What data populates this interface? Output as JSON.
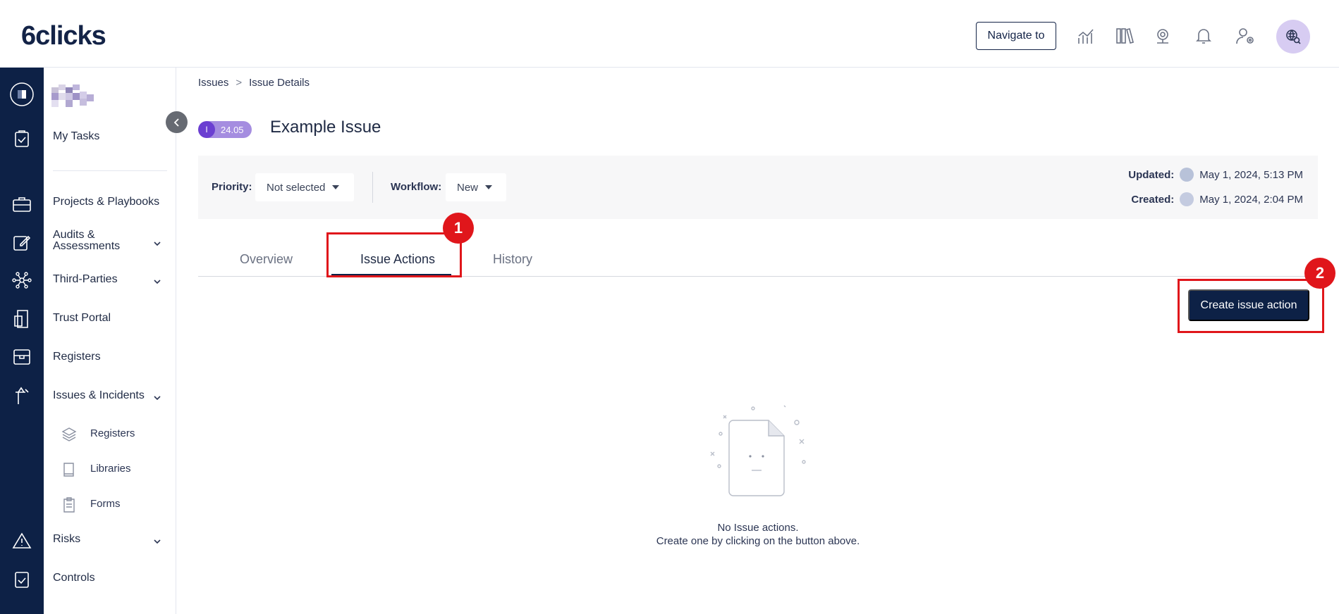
{
  "header": {
    "logo_text": "6clicks",
    "navigate_label": "Navigate to",
    "icons": [
      "analytics-icon",
      "library-icon",
      "webcam-icon",
      "bell-icon",
      "user-settings-icon",
      "global-search-icon"
    ]
  },
  "rail": {
    "icons": [
      "org-logo-icon",
      "tasks-icon",
      "briefcase-icon",
      "edit-icon",
      "network-icon",
      "trust-portal-icon",
      "registers-box-icon",
      "issues-icon",
      "warning-icon",
      "controls-icon"
    ]
  },
  "sidebar": {
    "items": [
      {
        "label": "My Tasks"
      },
      {
        "label": "Projects & Playbooks"
      },
      {
        "label": "Audits &\nAssessments"
      },
      {
        "label": "Third-Parties"
      },
      {
        "label": "Trust Portal"
      },
      {
        "label": "Registers"
      },
      {
        "label": "Issues & Incidents"
      },
      {
        "label": "Risks"
      },
      {
        "label": "Controls"
      }
    ],
    "sub_items": [
      {
        "label": "Registers",
        "icon": "layers-icon"
      },
      {
        "label": "Libraries",
        "icon": "book-icon"
      },
      {
        "label": "Forms",
        "icon": "clipboard-icon"
      }
    ]
  },
  "breadcrumb": {
    "items": [
      "Issues",
      "Issue Details"
    ],
    "separator": ">"
  },
  "issue": {
    "badge_letter": "I",
    "badge_value": "24.05",
    "title": "Example Issue"
  },
  "infobar": {
    "priority_label": "Priority:",
    "priority_value": "Not selected",
    "workflow_label": "Workflow:",
    "workflow_value": "New",
    "updated_label": "Updated:",
    "updated_value": "May 1, 2024, 5:13 PM",
    "created_label": "Created:",
    "created_value": "May 1, 2024, 2:04 PM"
  },
  "tabs": [
    {
      "label": "Overview",
      "active": false
    },
    {
      "label": "Issue Actions",
      "active": true
    },
    {
      "label": "History",
      "active": false
    }
  ],
  "callouts": [
    "1",
    "2"
  ],
  "create_button_label": "Create issue action",
  "empty_state": {
    "line1": "No Issue actions.",
    "line2": "Create one by clicking on the button above."
  },
  "colors": {
    "brand_navy": "#0d2146",
    "badge_purple": "#6b3fd1",
    "callout_red": "#e0161b"
  }
}
